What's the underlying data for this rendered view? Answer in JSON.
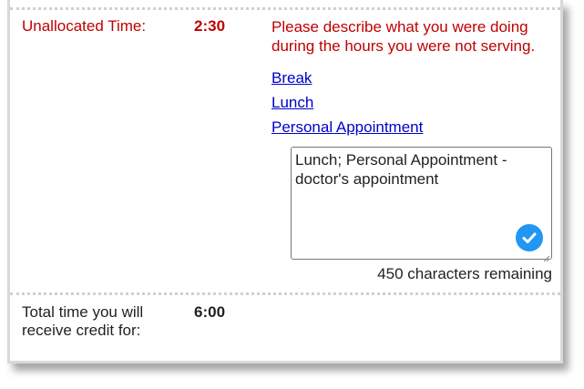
{
  "unallocated": {
    "label": "Unallocated Time:",
    "value": "2:30",
    "prompt": "Please describe what you were doing during the hours you were not serving."
  },
  "links": {
    "break": "Break",
    "lunch": "Lunch",
    "personal": "Personal Appointment"
  },
  "description": {
    "value": "Lunch; Personal Appointment - doctor's appointment",
    "chars_remaining": "450 characters remaining"
  },
  "total": {
    "label": "Total time you will receive credit for:",
    "value": "6:00"
  },
  "colors": {
    "alert_text": "#c00000",
    "link": "#0000cc",
    "check_badge": "#2196f3"
  },
  "icons": {
    "check": "check-icon",
    "resize": "resize-grip-icon"
  }
}
